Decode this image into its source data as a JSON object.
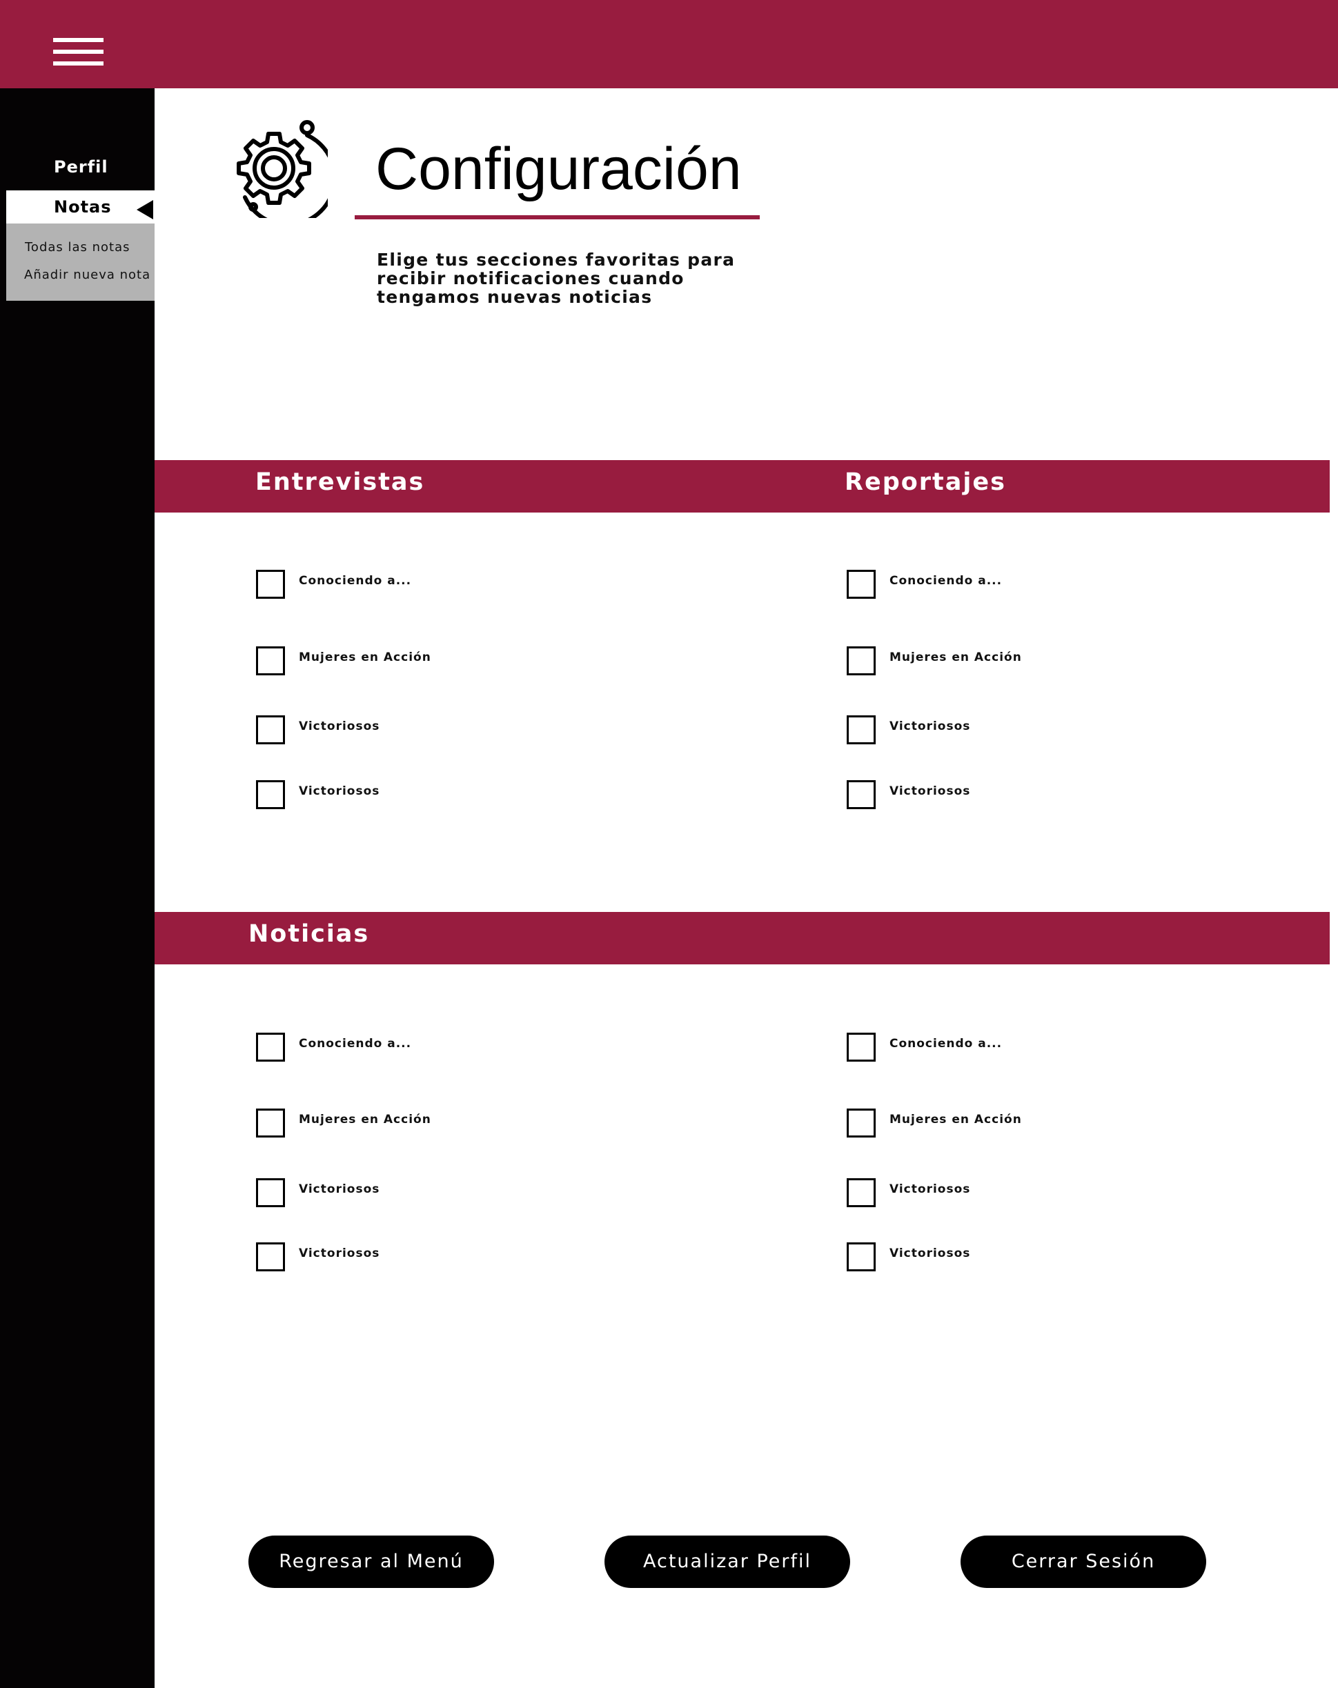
{
  "header": {
    "menu_icon": "hamburger-icon",
    "color": "#981c3f"
  },
  "sidebar": {
    "items": [
      {
        "label": "Perfil"
      },
      {
        "label": "Notas"
      }
    ],
    "submenu": [
      {
        "label": "Todas las notas"
      },
      {
        "label": "Añadir nueva nota"
      }
    ]
  },
  "page": {
    "icon": "gear-icon",
    "title": "Configuración",
    "description": "Elige tus secciones favoritas para recibir notificaciones cuando tengamos nuevas noticias"
  },
  "sections": {
    "entrevistas": {
      "title": "Entrevistas",
      "options": [
        "Conociendo a...",
        "Mujeres en Acción",
        "Victoriosos",
        "Victoriosos"
      ]
    },
    "reportajes": {
      "title": "Reportajes",
      "options": [
        "Conociendo a...",
        "Mujeres en Acción",
        "Victoriosos",
        "Victoriosos"
      ]
    },
    "noticias": {
      "title": "Noticias",
      "options_left": [
        "Conociendo a...",
        "Mujeres en Acción",
        "Victoriosos",
        "Victoriosos"
      ],
      "options_right": [
        "Conociendo a...",
        "Mujeres en Acción",
        "Victoriosos",
        "Victoriosos"
      ]
    }
  },
  "buttons": {
    "back": "Regresar al Menú",
    "update": "Actualizar Perfil",
    "logout": "Cerrar Sesión"
  }
}
